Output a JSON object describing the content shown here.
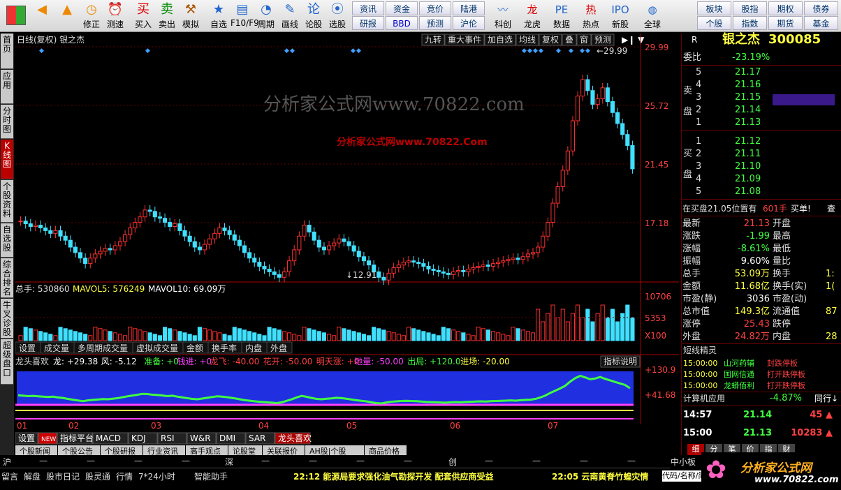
{
  "toolbar": {
    "big": [
      {
        "icon": "◀",
        "label": ""
      },
      {
        "icon": "▲",
        "label": ""
      },
      {
        "icon": "◷",
        "label": "修正"
      },
      {
        "icon": "⏰",
        "label": "测速"
      },
      {
        "icon": "买",
        "label": "买入"
      },
      {
        "icon": "卖",
        "label": "卖出"
      },
      {
        "icon": "⚒",
        "label": "模拟"
      },
      {
        "icon": "★",
        "label": "自选"
      },
      {
        "icon": "▤",
        "label": "F10/F9"
      },
      {
        "icon": "◔",
        "label": "周期"
      },
      {
        "icon": "✎",
        "label": "画线"
      },
      {
        "icon": "论",
        "label": "论股"
      },
      {
        "icon": "⦿",
        "label": "选股"
      }
    ],
    "mid": [
      "资讯",
      "资金",
      "竞价",
      "陆港",
      "研报",
      "BBD",
      "预测",
      "沪伦"
    ],
    "big2": [
      {
        "icon": "〰",
        "label": "科创"
      },
      {
        "icon": "龙",
        "label": "龙虎"
      },
      {
        "icon": "PE",
        "label": "数据"
      },
      {
        "icon": "热",
        "label": "热点"
      },
      {
        "icon": "IPO",
        "label": "新股"
      },
      {
        "icon": "◍",
        "label": "全球"
      }
    ],
    "right": [
      "板块",
      "股指",
      "期权",
      "债券",
      "个股",
      "指数",
      "期货",
      "基金"
    ]
  },
  "left_tabs": [
    "首页",
    "应用",
    "分时图",
    "K线图",
    "个股资料",
    "自选股",
    "综合排名",
    "牛叉诊股",
    "超级盘口"
  ],
  "chart_header": {
    "title": "日线(复权) 银之杰",
    "buttons": [
      "九转",
      "重大事件",
      "加自选",
      "均线",
      "复权",
      "叠",
      "窗",
      "预测"
    ]
  },
  "price_axis": [
    "29.99",
    "25.72",
    "21.45",
    "17.18"
  ],
  "price_annot": {
    "high": "29.99",
    "low": "12.91"
  },
  "volume": {
    "legend_total": "总手: 530860",
    "legend_ma5": "MAVOL5: 576249",
    "legend_ma10": "MAVOL10: 69.09万",
    "axis": [
      "10706",
      "5353",
      "X100"
    ],
    "buttons": [
      "设置",
      "成交量",
      "多周期成交量",
      "虚拟成交量",
      "金额",
      "换手率",
      "内盘",
      "外盘"
    ]
  },
  "indicator": {
    "name": "龙头喜欢",
    "legend": [
      {
        "t": "龙: +29.38",
        "c": "#fff"
      },
      {
        "t": "风: -5.12",
        "c": "#fff"
      },
      {
        "t": "准备: +0",
        "c": "#40ff40"
      },
      {
        "t": "钱进: +0",
        "c": "#ff40ff"
      },
      {
        "t": "龙飞: -40.00",
        "c": "#ff4040"
      },
      {
        "t": "花开: -50.00",
        "c": "#ff4040"
      },
      {
        "t": "明天涨: +0",
        "c": "#ff4040"
      },
      {
        "t": "地量: -50.00",
        "c": "#ff40ff"
      },
      {
        "t": "出局: +120.0",
        "c": "#40ff40"
      },
      {
        "t": "进场: -20.00",
        "c": "#ffff40"
      }
    ],
    "explain": "指标说明",
    "axis": [
      "+130.9",
      "+41.68"
    ]
  },
  "months": [
    "01",
    "02",
    "03",
    "04",
    "05",
    "06",
    "07"
  ],
  "bottom_tabs": [
    "设置",
    "NEW",
    "指标平台",
    "MACD",
    "KDJ",
    "RSI",
    "W&R",
    "DMI",
    "SAR",
    "龙头喜欢"
  ],
  "sub_tabs": [
    "个股新闻",
    "个股公告",
    "个股研报",
    "行业资讯",
    "高手观点",
    "论股堂",
    "关联报价",
    "AH股|个股",
    "商品价格"
  ],
  "watermark1": "分析家公式网www.70822.com",
  "watermark2": "分析家公式网www.70822.Com",
  "right": {
    "code": "300085",
    "name": "银之杰",
    "R": "R",
    "weibi_label": "委比",
    "weibi": "-23.19%",
    "sell": [
      {
        "n": "5",
        "p": "21.17"
      },
      {
        "n": "4",
        "p": "21.16"
      },
      {
        "n": "3",
        "p": "21.15"
      },
      {
        "n": "2",
        "p": "21.14"
      },
      {
        "n": "1",
        "p": "21.13"
      }
    ],
    "buy": [
      {
        "n": "1",
        "p": "21.12"
      },
      {
        "n": "2",
        "p": "21.11"
      },
      {
        "n": "3",
        "p": "21.10"
      },
      {
        "n": "4",
        "p": "21.09"
      },
      {
        "n": "5",
        "p": "21.08"
      }
    ],
    "sell_label": "卖盘",
    "buy_label": "买盘",
    "order_text": "在买盘21.05位置有",
    "order_qty": "601手",
    "order_tag": "买单!",
    "order_chk": "查",
    "stats": [
      {
        "l": "最新",
        "v": "21.13",
        "c": "red",
        "l2": "开盘",
        "v2": ""
      },
      {
        "l": "涨跌",
        "v": "-1.99",
        "c": "grn",
        "l2": "最高",
        "v2": ""
      },
      {
        "l": "涨幅",
        "v": "-8.61%",
        "c": "grn",
        "l2": "最低",
        "v2": ""
      },
      {
        "l": "振幅",
        "v": "9.60%",
        "c": "wht",
        "l2": "量比",
        "v2": ""
      },
      {
        "l": "总手",
        "v": "53.09万",
        "c": "yel",
        "l2": "换手",
        "v2": "1:"
      },
      {
        "l": "金额",
        "v": "11.68亿",
        "c": "yel",
        "l2": "换手(实)",
        "v2": "1("
      },
      {
        "l": "市盈(静)",
        "v": "3036",
        "c": "wht",
        "l2": "市盈(动)",
        "v2": ""
      },
      {
        "l": "总市值",
        "v": "149.3亿",
        "c": "yel",
        "l2": "流通值",
        "v2": "87"
      },
      {
        "l": "涨停",
        "v": "25.43",
        "c": "red",
        "l2": "跌停",
        "v2": ""
      },
      {
        "l": "外盘",
        "v": "24.82万",
        "c": "red",
        "l2": "内盘",
        "v2": "28"
      }
    ],
    "short_title": "短线精灵",
    "short": [
      {
        "t": "15:00:00",
        "n": "山河药辅",
        "e": "封跌停板"
      },
      {
        "t": "15:00:00",
        "n": "国网信通",
        "e": "打开跌停板"
      },
      {
        "t": "15:00:00",
        "n": "龙蟒佰利",
        "e": "打开跌停板"
      }
    ],
    "sector_label": "计算机应用",
    "sector_val": "-4.87%",
    "sector_link": "同行↓",
    "ticks": [
      {
        "t": "14:57",
        "p": "21.14",
        "v": "45",
        "d": "up"
      },
      {
        "t": "15:00",
        "p": "21.13",
        "v": "10283",
        "d": "up"
      }
    ],
    "detail_tabs": [
      "细",
      "分",
      "笔",
      "价",
      "指",
      "财"
    ]
  },
  "status": {
    "idx": [
      {
        "n": "沪",
        "v": "—"
      },
      {
        "n": "深",
        "v": "—"
      },
      {
        "n": "创",
        "v": "—"
      }
    ],
    "small": "中小板",
    "items": [
      "留言",
      "解盘",
      "股市日记",
      "股灵通",
      "行情",
      "7*24小时",
      "智能助手"
    ],
    "news1": "22:12 能源局要求强化油气勘探开发 配套供应商受益",
    "news2": "22:05 云南黄脊竹蝗灾情",
    "code_hint": "代码/名称/简",
    "brand": "分析家公式网",
    "brand_url": "www.70822.com"
  }
}
